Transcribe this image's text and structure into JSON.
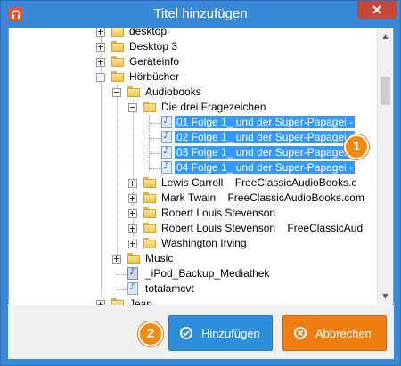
{
  "window": {
    "title": "Titel hinzufügen"
  },
  "tree": {
    "items": [
      {
        "label": "desktop"
      },
      {
        "label": "Desktop 3"
      },
      {
        "label": "Geräteinfo"
      },
      {
        "label": "Hörbücher"
      },
      {
        "label": "Audiobooks"
      },
      {
        "label": "Die drei Fragezeichen"
      },
      {
        "label": "01 Folge 1_ und der Super-Papagei -"
      },
      {
        "label": "02 Folge 1_ und der Super-Papagei -"
      },
      {
        "label": "03 Folge 1_ und der Super-Papagei -"
      },
      {
        "label": "04 Folge 1_ und der Super-Papagei -"
      },
      {
        "label": "Lewis Carroll    FreeClassicAudioBooks.c"
      },
      {
        "label": "Mark Twain    FreeClassicAudioBooks.com"
      },
      {
        "label": "Robert Louis Stevenson"
      },
      {
        "label": "Robert Louis Stevenson    FreeClassicAud"
      },
      {
        "label": "Washington Irving"
      },
      {
        "label": "Music"
      },
      {
        "label": "_iPod_Backup_Mediathek"
      },
      {
        "label": "totalamcvt"
      },
      {
        "label": "Jean"
      }
    ]
  },
  "callouts": {
    "one": "1",
    "two": "2"
  },
  "buttons": {
    "add": "Hinzufügen",
    "cancel": "Abbrechen"
  },
  "colors": {
    "accent": "#3a88d8",
    "selection": "#3399ff",
    "add_button": "#2e8ede",
    "cancel_button": "#f07d12",
    "callout": "#f28a10"
  }
}
